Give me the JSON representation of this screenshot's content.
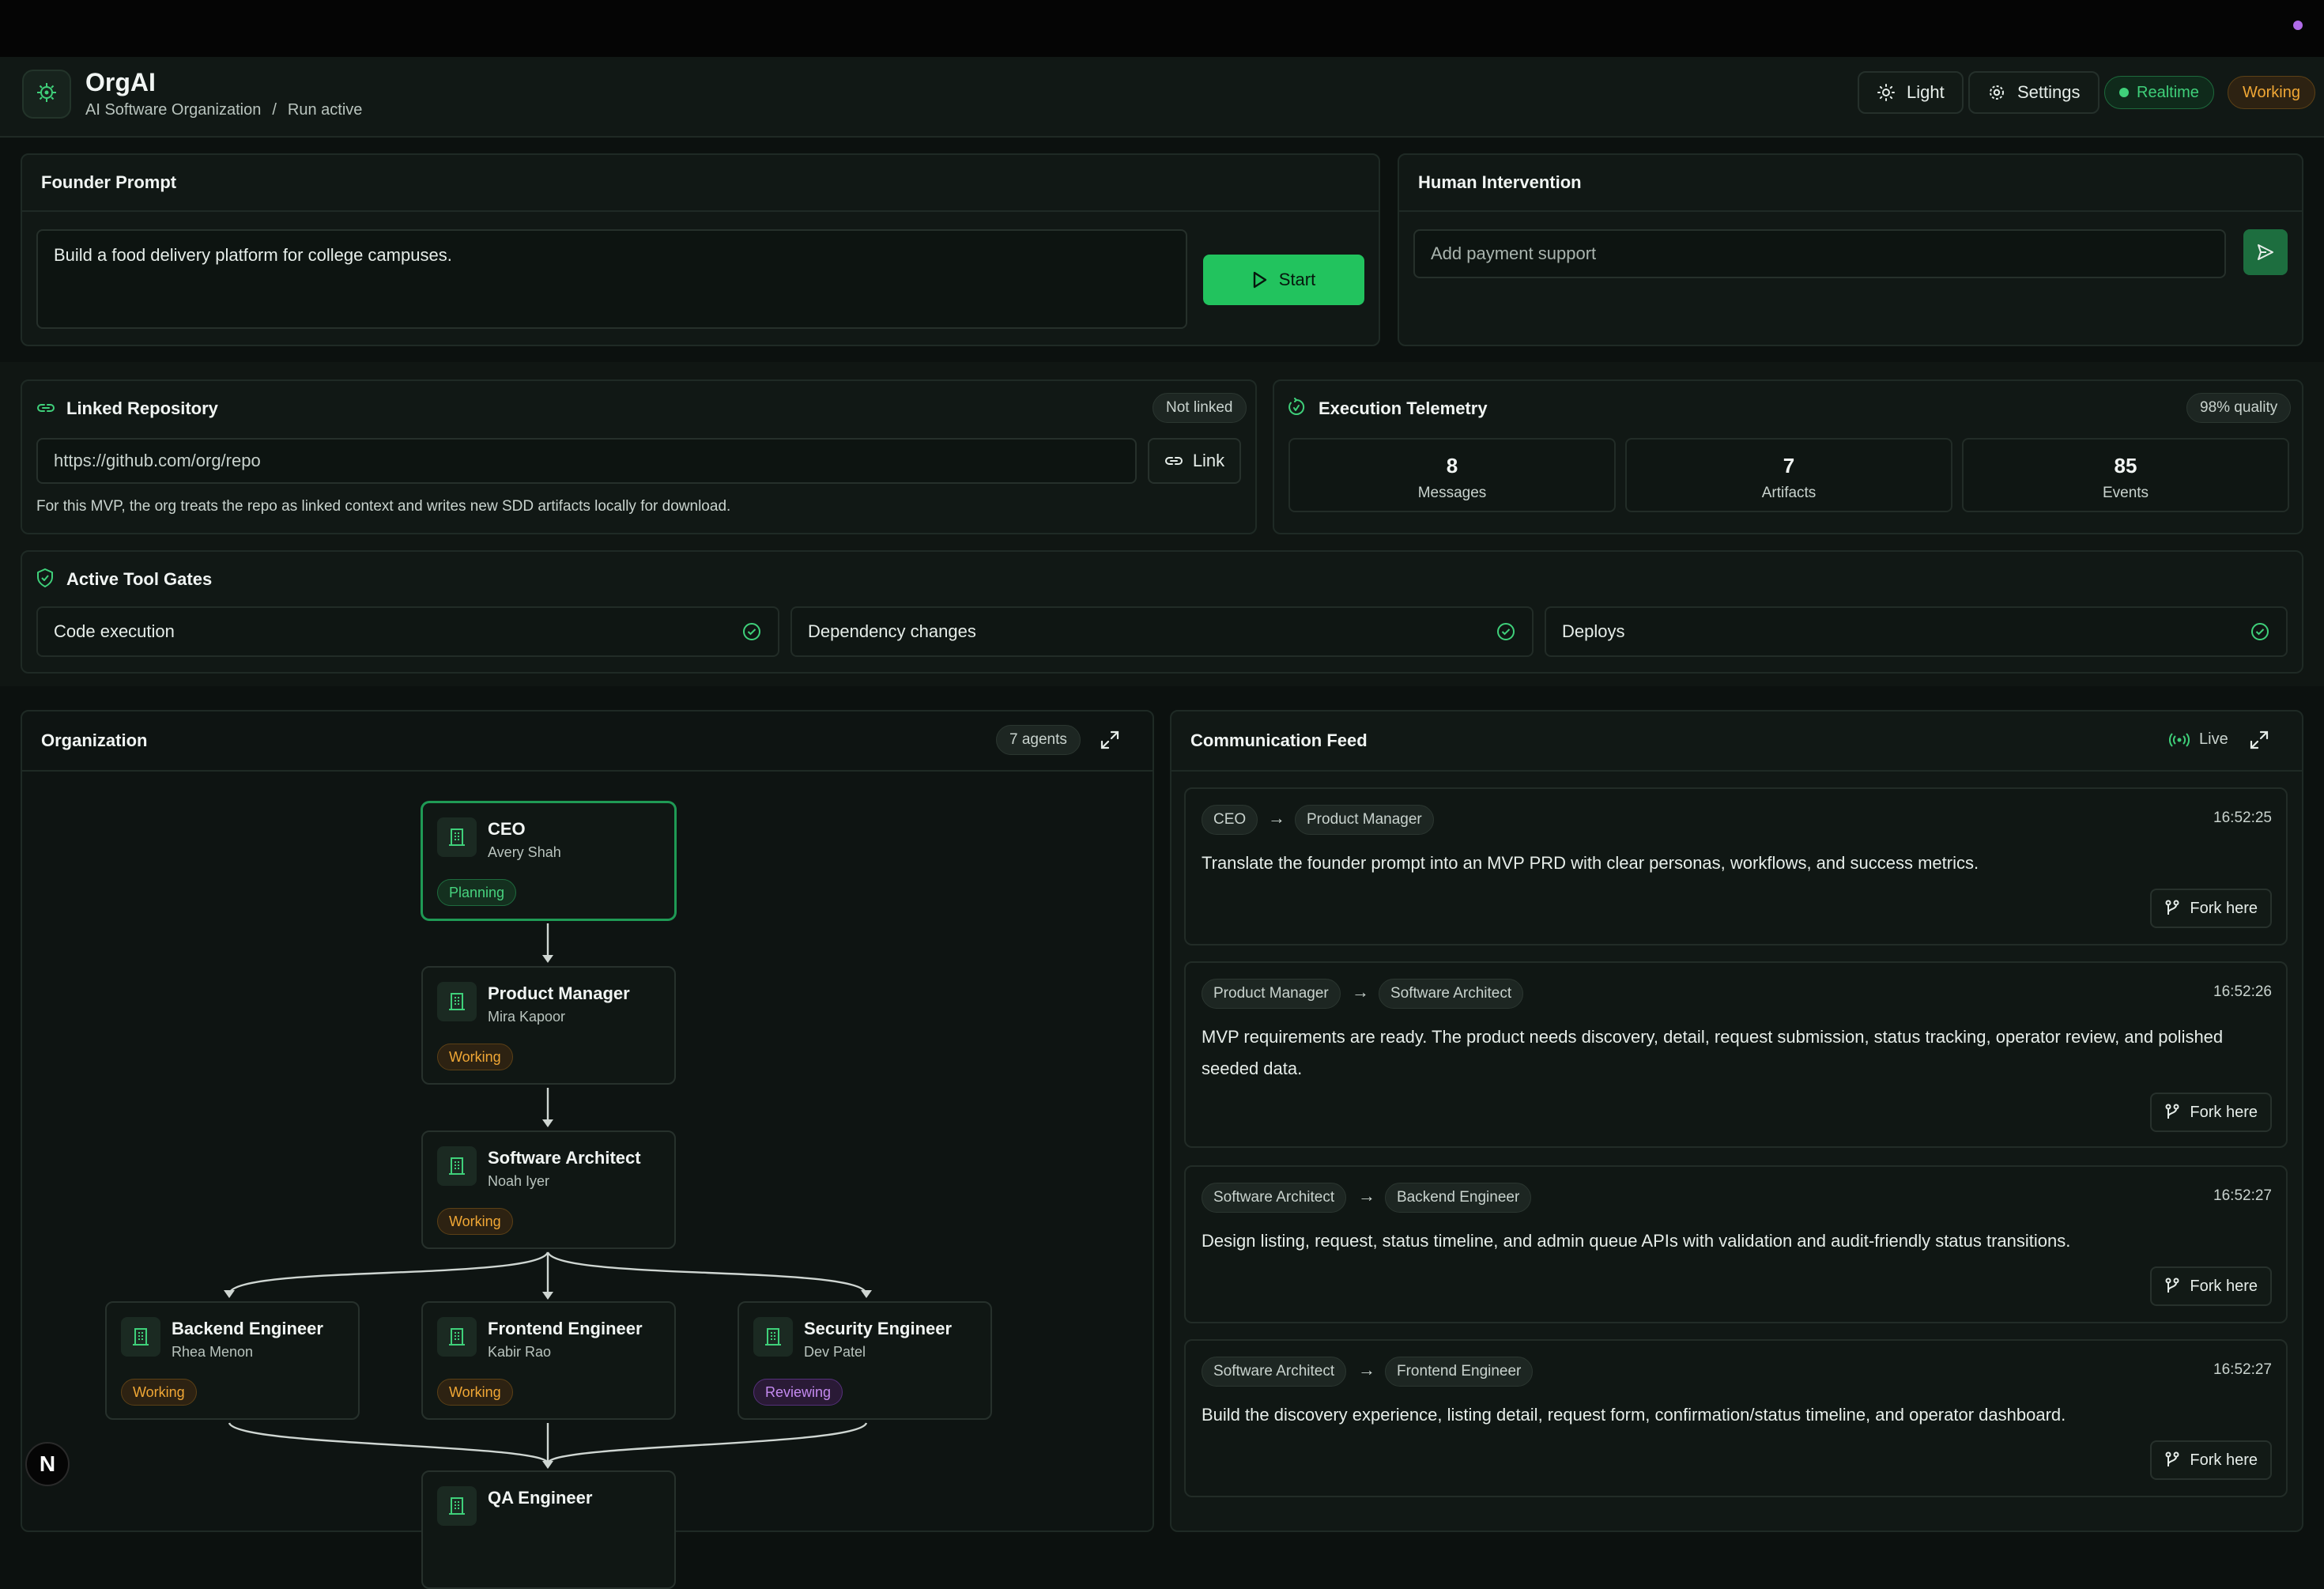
{
  "app": {
    "title": "OrgAI",
    "breadcrumb": [
      "AI Software Organization",
      "Run active"
    ],
    "breadcrumb_sep": "/"
  },
  "header": {
    "theme_label": "Light",
    "settings_label": "Settings",
    "realtime_label": "Realtime",
    "status_label": "Working"
  },
  "founder": {
    "title": "Founder Prompt",
    "prompt": "Build a food delivery platform for college campuses.",
    "start_label": "Start"
  },
  "intervention": {
    "title": "Human Intervention",
    "placeholder": "Add payment support"
  },
  "repo": {
    "title": "Linked Repository",
    "status": "Not linked",
    "placeholder": "https://github.com/org/repo",
    "link_label": "Link",
    "note": "For this MVP, the org treats the repo as linked context and writes new SDD artifacts locally for download."
  },
  "telemetry": {
    "title": "Execution Telemetry",
    "quality": "98% quality",
    "stats": [
      {
        "value": "8",
        "label": "Messages"
      },
      {
        "value": "7",
        "label": "Artifacts"
      },
      {
        "value": "85",
        "label": "Events"
      }
    ]
  },
  "gates": {
    "title": "Active Tool Gates",
    "items": [
      "Code execution",
      "Dependency changes",
      "Deploys"
    ]
  },
  "org": {
    "title": "Organization",
    "count": "7 agents",
    "nodes": [
      {
        "role": "CEO",
        "person": "Avery Shah",
        "status": "Planning"
      },
      {
        "role": "Product Manager",
        "person": "Mira Kapoor",
        "status": "Working"
      },
      {
        "role": "Software Architect",
        "person": "Noah Iyer",
        "status": "Working"
      },
      {
        "role": "Backend Engineer",
        "person": "Rhea Menon",
        "status": "Working"
      },
      {
        "role": "Frontend Engineer",
        "person": "Kabir Rao",
        "status": "Working"
      },
      {
        "role": "Security Engineer",
        "person": "Dev Patel",
        "status": "Reviewing"
      },
      {
        "role": "QA Engineer",
        "person": "",
        "status": ""
      }
    ]
  },
  "feed": {
    "title": "Communication Feed",
    "live_label": "Live",
    "fork_label": "Fork here",
    "arrow": "→",
    "messages": [
      {
        "from": "CEO",
        "to": "Product Manager",
        "time": "16:52:25",
        "text": "Translate the founder prompt into an MVP PRD with clear personas, workflows, and success metrics."
      },
      {
        "from": "Product Manager",
        "to": "Software Architect",
        "time": "16:52:26",
        "text": "MVP requirements are ready. The product needs discovery, detail, request submission, status tracking, operator review, and polished seeded data."
      },
      {
        "from": "Software Architect",
        "to": "Backend Engineer",
        "time": "16:52:27",
        "text": "Design listing, request, status timeline, and admin queue APIs with validation and audit-friendly status transitions."
      },
      {
        "from": "Software Architect",
        "to": "Frontend Engineer",
        "time": "16:52:27",
        "text": "Build the discovery experience, listing detail, request form, confirmation/status timeline, and operator dashboard."
      }
    ]
  },
  "misc": {
    "next_badge": "N"
  },
  "colors": {
    "accent": "#22c35e",
    "working": "#f0a735",
    "reviewing": "#c48af0",
    "planning": "#47d27e"
  }
}
